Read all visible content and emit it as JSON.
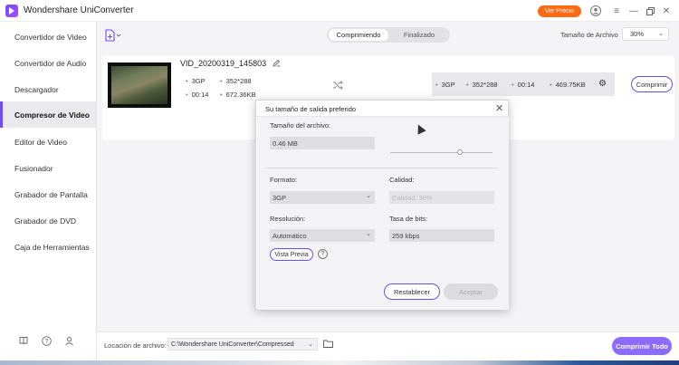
{
  "app": {
    "title": "Wondershare UniConverter",
    "price_button": "Ver Precio"
  },
  "titlebar_icons": [
    "user-icon",
    "menu-icon",
    "minimize-icon",
    "maximize-icon",
    "close-icon"
  ],
  "sidebar": {
    "items": [
      {
        "label": "Convertidor de Video"
      },
      {
        "label": "Convertidor de Audio"
      },
      {
        "label": "Descargador"
      },
      {
        "label": "Compresor de Video",
        "active": true
      },
      {
        "label": "Editor de Video"
      },
      {
        "label": "Fusionador"
      },
      {
        "label": "Grabador de Pantalla"
      },
      {
        "label": "Grabador de DVD"
      },
      {
        "label": "Caja de Herramientas"
      }
    ]
  },
  "toolbar": {
    "tabs": [
      {
        "label": "Comprimiendo",
        "active": true
      },
      {
        "label": "Finalizado"
      }
    ],
    "size_label": "Tamaño de Archivo",
    "size_value": "30%"
  },
  "file": {
    "name": "VID_20200319_145803",
    "format": "3GP",
    "resolution": "352*288",
    "duration": "00:14",
    "size": "672.36KB",
    "output": {
      "format": "3GP",
      "resolution": "352*288",
      "duration": "00:14",
      "size": "469.75KB"
    },
    "compress_button": "Comprimir"
  },
  "footer": {
    "location_label": "Locación de archivo:",
    "location_value": "C:\\Wondershare UniConverter\\Compressed",
    "compress_all": "Comprimir Todo"
  },
  "dialog": {
    "title": "Su tamaño de salida preferido",
    "file_size_label": "Tamaño del archivo:",
    "file_size_value": "0.46 MB",
    "slider_fraction": 0.68,
    "format_label": "Formato:",
    "format_value": "3GP",
    "quality_label": "Calidad:",
    "quality_value": "Calidad: 38%",
    "resolution_label": "Resolución:",
    "resolution_value": "Automático",
    "bitrate_label": "Tasa de bits:",
    "bitrate_value": "259 kbps",
    "preview_button": "Vista Previa",
    "reset_button": "Restablecer",
    "accept_button": "Aceptar"
  }
}
